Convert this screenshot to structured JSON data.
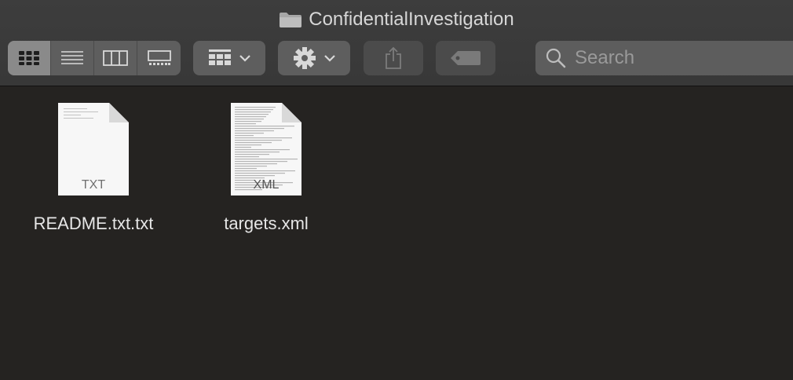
{
  "window": {
    "title": "ConfidentialInvestigation"
  },
  "toolbar": {
    "view_modes": [
      "icon-view",
      "list-view",
      "column-view",
      "gallery-view"
    ],
    "active_view": "icon-view",
    "search": {
      "placeholder": "Search",
      "value": ""
    }
  },
  "files": [
    {
      "name": "README.txt.txt",
      "ext": "TXT"
    },
    {
      "name": "targets.xml",
      "ext": "XML"
    }
  ],
  "colors": {
    "background": "#252321",
    "toolbar": "#3a3a3a",
    "button": "#5e5e5e",
    "active_button": "#8a8a8a",
    "text": "#e6e6e6"
  }
}
